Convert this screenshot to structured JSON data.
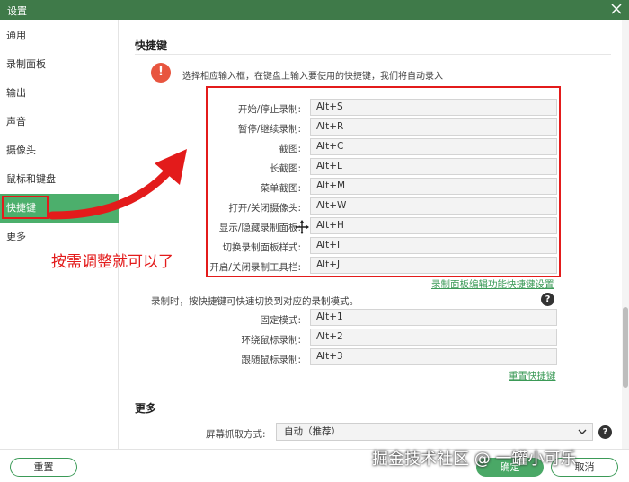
{
  "window": {
    "title": "设置"
  },
  "sidebar": {
    "items": [
      {
        "label": "通用"
      },
      {
        "label": "录制面板"
      },
      {
        "label": "输出"
      },
      {
        "label": "声音"
      },
      {
        "label": "摄像头"
      },
      {
        "label": "鼠标和键盘"
      },
      {
        "label": "快捷键"
      },
      {
        "label": "更多"
      }
    ],
    "active": "快捷键"
  },
  "shortcuts": {
    "title": "快捷键",
    "hint": "选择相应输入框，在键盘上输入要使用的快捷键，我们将自动录入",
    "rows": [
      {
        "label": "开始/停止录制:",
        "value": "Alt+S"
      },
      {
        "label": "暂停/继续录制:",
        "value": "Alt+R"
      },
      {
        "label": "截图:",
        "value": "Alt+C"
      },
      {
        "label": "长截图:",
        "value": "Alt+L"
      },
      {
        "label": "菜单截图:",
        "value": "Alt+M"
      },
      {
        "label": "打开/关闭摄像头:",
        "value": "Alt+W"
      },
      {
        "label": "显示/隐藏录制面板:",
        "value": "Alt+H"
      },
      {
        "label": "切换录制面板样式:",
        "value": "Alt+I"
      },
      {
        "label": "开启/关闭录制工具栏:",
        "value": "Alt+J"
      }
    ],
    "panel_link": "录制面板编辑功能快捷键设置",
    "mode_hint": "录制时，按快捷键可快速切换到对应的录制模式。",
    "mode_rows": [
      {
        "label": "固定模式:",
        "value": "Alt+1"
      },
      {
        "label": "环绕鼠标录制:",
        "value": "Alt+2"
      },
      {
        "label": "跟随鼠标录制:",
        "value": "Alt+3"
      }
    ],
    "reset_link": "重置快捷键"
  },
  "more": {
    "title": "更多",
    "capture_label": "屏幕抓取方式:",
    "capture_value": "自动（推荐）"
  },
  "footer": {
    "reset": "重置",
    "ok": "确定",
    "cancel": "取消"
  },
  "annotation": {
    "text": "按需调整就可以了"
  },
  "watermark": {
    "text": "掘金技术社区 @ 一罐小可乐"
  },
  "colors": {
    "titlebar": "#3f7a49",
    "accent": "#4caf6c",
    "highlight_red": "#e31b1b",
    "warning": "#e8553f"
  },
  "icons": {
    "close": "close-icon",
    "warning": "exclamation-icon",
    "help": "question-icon",
    "dropdown": "chevron-down-icon"
  }
}
